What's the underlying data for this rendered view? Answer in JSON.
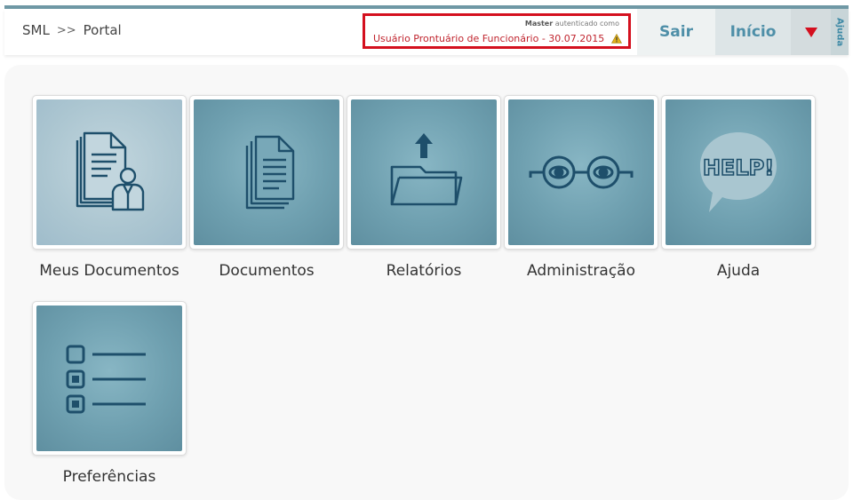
{
  "header": {
    "breadcrumb": [
      "SML",
      ">>",
      "Portal"
    ],
    "auth": {
      "role": "Master",
      "authenticated_text": "autenticado como",
      "user": "Usuário Prontuário de Funcionário - 30.07.2015"
    },
    "buttons": {
      "sair": "Sair",
      "inicio": "Início"
    },
    "ajuda_tab": "Ajuda",
    "colors": {
      "accent": "#4e8fa8",
      "alert": "#d4101e"
    }
  },
  "tiles": [
    {
      "label": "Meus Documentos",
      "icon": "user-documents-icon"
    },
    {
      "label": "Documentos",
      "icon": "documents-icon"
    },
    {
      "label": "Relatórios",
      "icon": "folder-upload-icon"
    },
    {
      "label": "Administração",
      "icon": "glasses-icon"
    },
    {
      "label": "Ajuda",
      "icon": "help-bubble-icon",
      "icon_text": "HELP!"
    },
    {
      "label": "Preferências",
      "icon": "checklist-icon"
    }
  ]
}
